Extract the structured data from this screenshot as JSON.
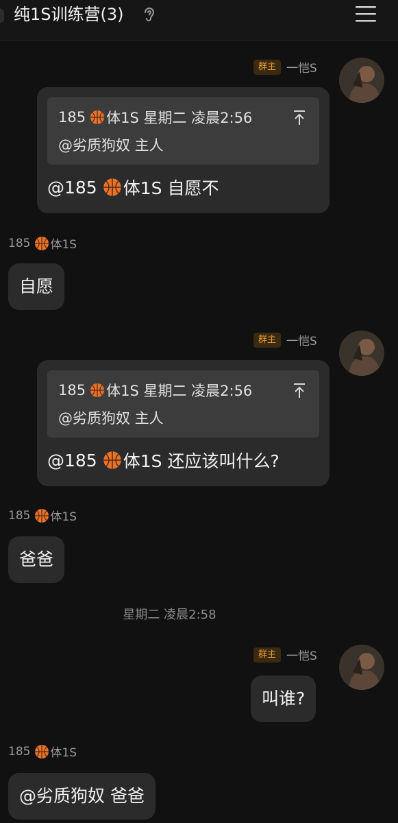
{
  "header": {
    "title": "纯1S训练营(3)",
    "ear_icon": "ear-icon",
    "menu_icon": "menu-icon"
  },
  "owner": {
    "badge": "群主",
    "name": "一恺S"
  },
  "member": {
    "name_prefix": "185",
    "name_suffix": "体1S",
    "name_icon": "basketball-icon"
  },
  "messages": [
    {
      "quote_header_prefix": "185",
      "quote_header_suffix": "体1S  星期二  凌晨2:56",
      "quote_body": "@劣质狗奴  主人",
      "reply_prefix": "@185",
      "reply_suffix": "体1S  自愿不"
    },
    {
      "text": "自愿"
    },
    {
      "quote_header_prefix": "185",
      "quote_header_suffix": "体1S  星期二  凌晨2:56",
      "quote_body": "@劣质狗奴  主人",
      "reply_prefix": "@185",
      "reply_suffix": "体1S  还应该叫什么?"
    },
    {
      "text": "爸爸"
    },
    {
      "text": "叫谁?"
    },
    {
      "text": "@劣质狗奴  爸爸"
    }
  ],
  "time_separator": "星期二  凌晨2:58",
  "colors": {
    "background": "#111111",
    "bubble": "#2b2b2b",
    "quote_box": "#3c3c3c",
    "badge_text": "#e59a2d",
    "badge_bg": "#3a2a12"
  }
}
